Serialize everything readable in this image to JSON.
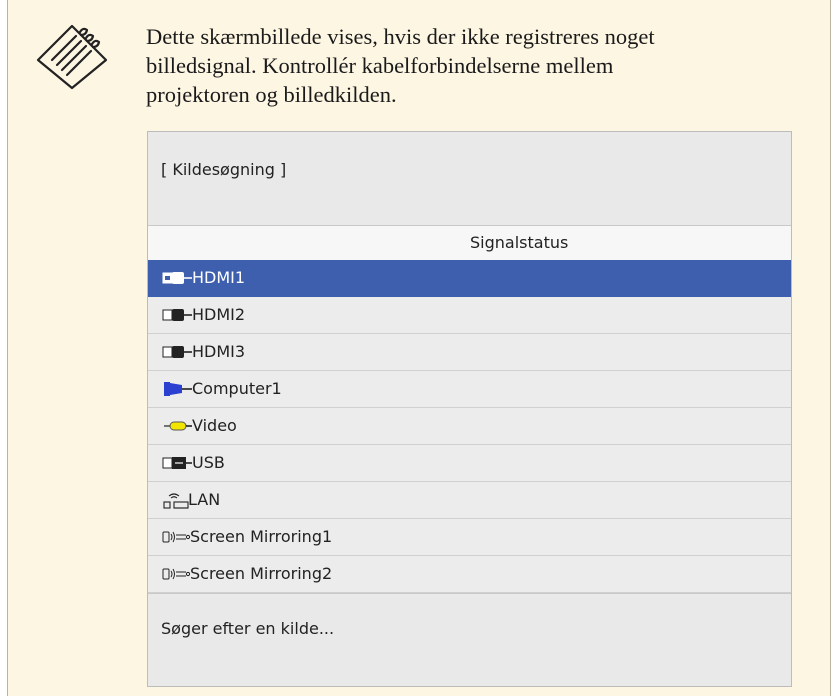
{
  "note": {
    "icon": "note-pencil-icon",
    "text_lines": [
      "Dette skærmbillede vises, hvis der ikke registreres noget",
      "billedsignal. Kontrollér kabelforbindelserne mellem",
      "projektoren og billedkilden."
    ]
  },
  "dialog": {
    "title": "[ Kildesøgning ]",
    "column_header": "Signalstatus",
    "selected_index": 0,
    "sources": [
      {
        "label": "HDMI1",
        "icon": "hdmi-plug-icon"
      },
      {
        "label": "HDMI2",
        "icon": "hdmi-plug-icon"
      },
      {
        "label": "HDMI3",
        "icon": "hdmi-plug-icon"
      },
      {
        "label": "Computer1",
        "icon": "vga-plug-icon"
      },
      {
        "label": "Video",
        "icon": "rca-plug-icon"
      },
      {
        "label": "USB",
        "icon": "usb-plug-icon"
      },
      {
        "label": "LAN",
        "icon": "wireless-lan-icon"
      },
      {
        "label": "Screen Mirroring1",
        "icon": "screen-mirroring-icon"
      },
      {
        "label": "Screen Mirroring2",
        "icon": "screen-mirroring-icon"
      }
    ],
    "status_text": "Søger efter en kilde..."
  },
  "colors": {
    "note_background": "#fdf6e3",
    "selection": "#3e5fae",
    "vga_plug": "#2b3fd0",
    "rca_plug": "#f2e600"
  }
}
